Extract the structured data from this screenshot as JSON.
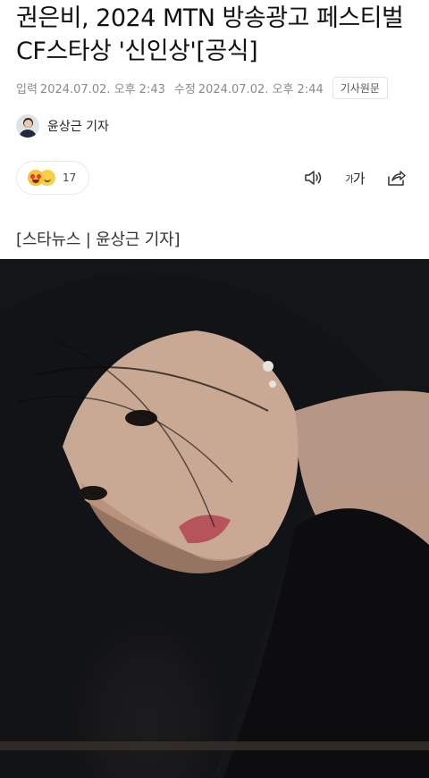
{
  "article": {
    "title": "권은비, 2024 MTN 방송광고 페스티벌 CF스타상 '신인상'[공식]",
    "published_label": "입력",
    "published": "2024.07.02. 오후 2:43",
    "modified_label": "수정",
    "modified": "2024.07.02. 오후 2:44",
    "origin_button": "기사원문",
    "reporter": "윤상근 기자",
    "reaction_count": "17",
    "font_size_glyph_small": "가",
    "font_size_glyph_large": "가",
    "source_line": "[스타뉴스 | 윤상근 기자]"
  },
  "icons": {
    "reaction_emojis": [
      "heart-eyes",
      "smile"
    ],
    "audio": "speaker-icon",
    "share": "share-icon"
  },
  "colors": {
    "meta_text": "#8a8a8a",
    "photo_bg": "#141518"
  }
}
